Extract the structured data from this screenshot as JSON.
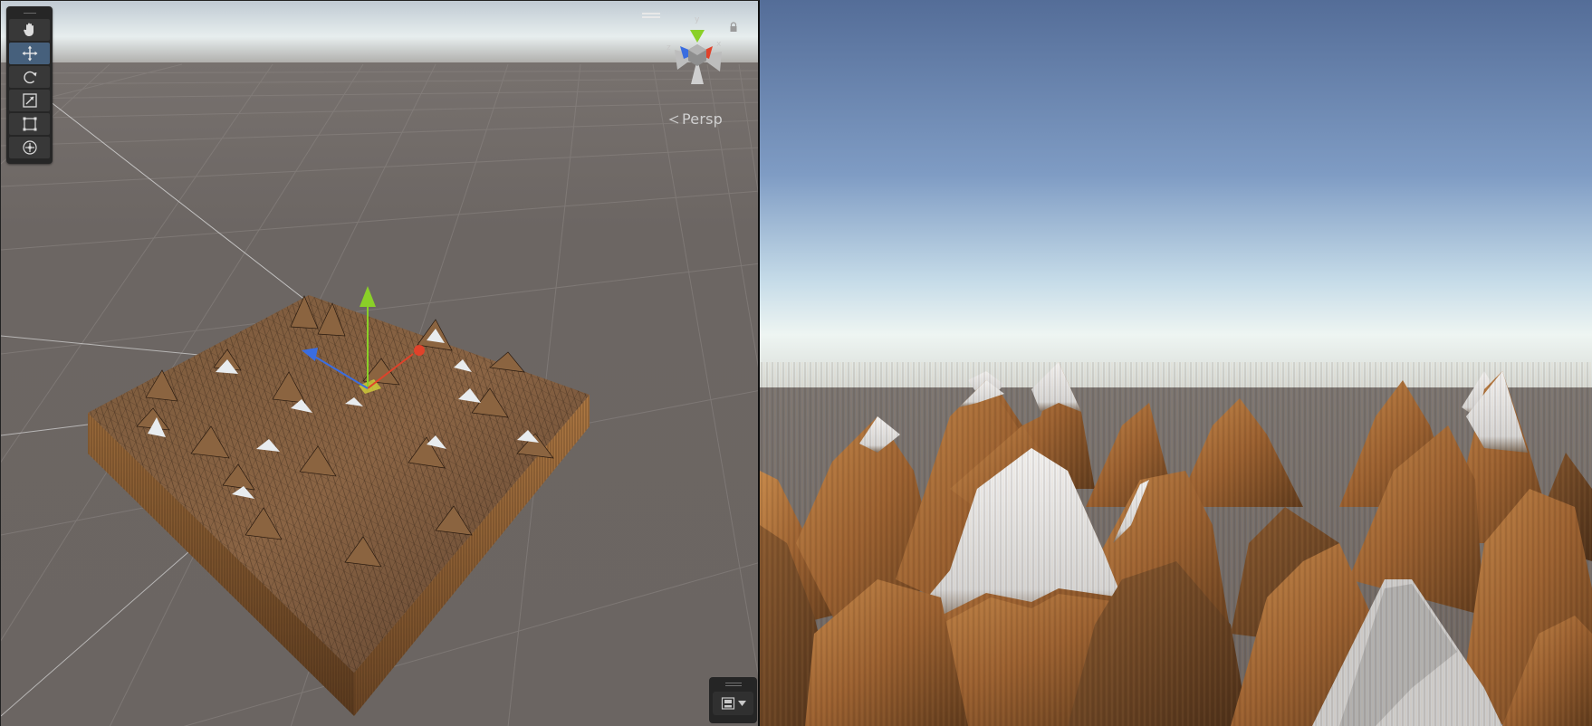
{
  "scene_view": {
    "camera_mode_label": "Persp",
    "axis_labels": {
      "y": "y",
      "x": "x",
      "z": "z"
    },
    "tools": [
      {
        "name": "hand-tool",
        "icon": "hand-icon",
        "active": false
      },
      {
        "name": "move-tool",
        "icon": "move-arrows-icon",
        "active": true
      },
      {
        "name": "rotate-tool",
        "icon": "rotate-icon",
        "active": false
      },
      {
        "name": "scale-tool",
        "icon": "scale-icon",
        "active": false
      },
      {
        "name": "rect-tool",
        "icon": "rect-transform-icon",
        "active": false
      },
      {
        "name": "transform-tool",
        "icon": "transform-icon",
        "active": false
      }
    ],
    "overlay_button_icon": "camera-overlay-icon",
    "colors": {
      "ground": "#6b6562",
      "sky_top": "#c6cfd8",
      "horizon": "#f0f4f2",
      "gizmo_y": "#8ad028",
      "gizmo_x": "#e0422a",
      "gizmo_z": "#3a6de0",
      "toolbar_active": "#46607c"
    }
  },
  "game_view": {
    "colors": {
      "sky_top": "#546d98",
      "sky_mid": "#8aa6c8",
      "horizon": "#eef5f2",
      "ground": "#6c6562",
      "rock": "#a86d35",
      "snow": "#e6e6e6"
    }
  }
}
